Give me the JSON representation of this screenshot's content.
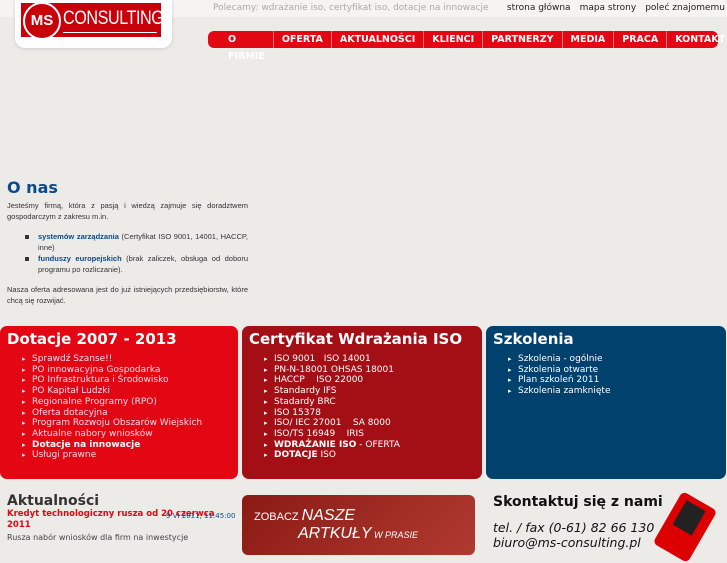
{
  "header": {
    "tagline": "Polecamy: wdrażanie iso, certyfikat iso, dotacje na innowacje",
    "links": [
      "strona główna",
      "mapa strony",
      "poleć znajomemu"
    ],
    "logo_ms": "MS",
    "logo_text": "CONSULTING"
  },
  "nav": [
    "O FIRMIE",
    "OFERTA",
    "AKTUALNOŚCI",
    "KLIENCI",
    "PARTNERZY",
    "MEDIA",
    "PRACA",
    "KONTAKT"
  ],
  "about": {
    "title": "O nas",
    "intro": "Jesteśmy firmą, która z pasją i wiedzą zajmuje się doradztwem gospodarczym z zakresu m.in.",
    "items": [
      {
        "bold": "systemów zarządzania",
        "rest": " (Certyfikat ISO 9001, 14001, HACCP, inne)"
      },
      {
        "bold": "funduszy europejskich",
        "rest": " (brak zaliczek, obsługa od doboru programu po rozliczanie)."
      }
    ],
    "outro": "Nasza oferta adresowana jest do już istniejących przedsiębiorstw, które chcą się rozwijać."
  },
  "dotacje": {
    "title": "Dotacje 2007 - 2013",
    "items": [
      "Sprawdź Szanse!!",
      "PO innowacyjna Gospodarka",
      "PO Infrastruktura i Środowisko",
      "PO Kapitał Ludzki",
      "Regionalne Programy (RPO)",
      "Oferta dotacyjna",
      "Program Rozwoju Obszarów Wiejskich",
      "Aktualne nabory wniosków",
      "Dotacje na innowacje",
      "Usługi prawne"
    ]
  },
  "iso": {
    "title": "Certyfikat Wdrażania ISO",
    "items": [
      "ISO 9001   ISO 14001",
      "PN-N-18001 OHSAS 18001",
      "HACCP    ISO 22000",
      "Standardy IFS",
      "Stadardy BRC",
      "ISO 15378",
      "ISO/ IEC 27001    SA 8000",
      "ISO/TS 16949    IRIS"
    ],
    "wdr_bold": "WDRAŻANIE ISO",
    "wdr_rest": " - OFERTA",
    "dot_bold": "DOTACJE",
    "dot_rest": " ISO"
  },
  "szkolenia": {
    "title": "Szkolenia",
    "items": [
      "Szkolenia - ogólnie",
      "Szkolenia otwarte",
      "Plan szkoleń 2011",
      "Szkolenia zamknięte"
    ]
  },
  "news": {
    "title": "Aktualności",
    "headline": "Kredyt technologiczny rusza od 20 czerwca 2011",
    "date": "9 VI 2011, 11:45:00",
    "excerpt": "Rusza nabór wniosków dla firm na inwestycje"
  },
  "banner": {
    "l1a": "ZOBACZ ",
    "l1b": "NASZE",
    "l2a": "ARTKUŁY",
    "l2b": " W PRASIE"
  },
  "contact": {
    "title": "Skontaktuj się z nami",
    "tel": "tel. / fax (0-61) 82 66 130",
    "email": "biuro@ms-consulting.pl"
  }
}
